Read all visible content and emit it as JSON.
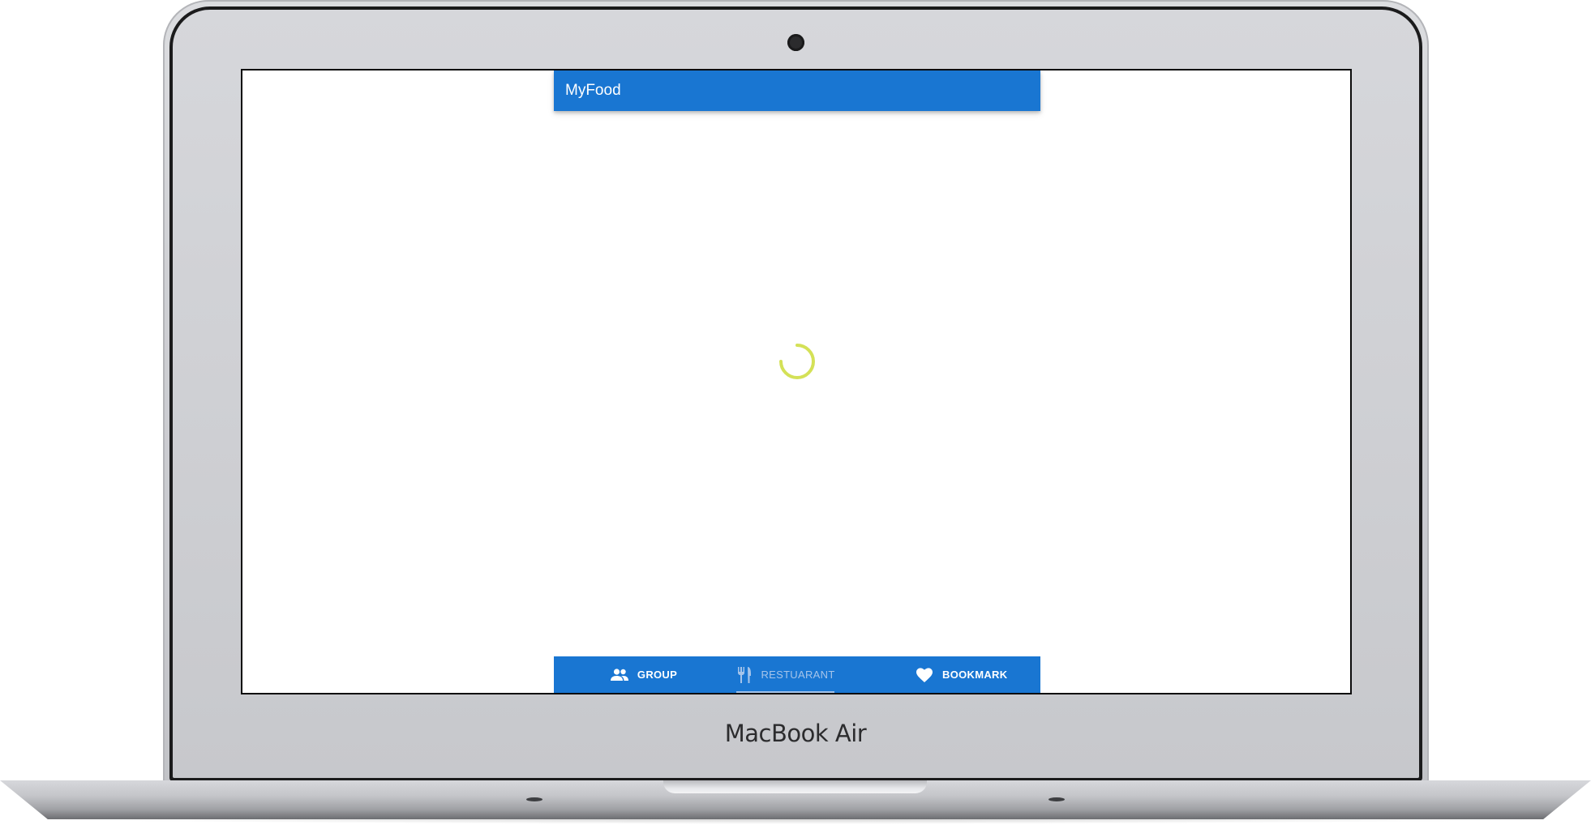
{
  "device": {
    "brand_label": "MacBook Air"
  },
  "app": {
    "title": "MyFood",
    "loading": true,
    "theme": {
      "primary": "#1976d2",
      "spinner": "#d4e157",
      "inactive_tab": "#a5c4ea"
    }
  },
  "bottom_nav": {
    "items": [
      {
        "label": "GROUP",
        "icon": "group-icon",
        "active": false
      },
      {
        "label": "RESTUARANT",
        "icon": "restaurant-icon",
        "active": true
      },
      {
        "label": "BOOKMARK",
        "icon": "heart-icon",
        "active": false
      }
    ]
  }
}
